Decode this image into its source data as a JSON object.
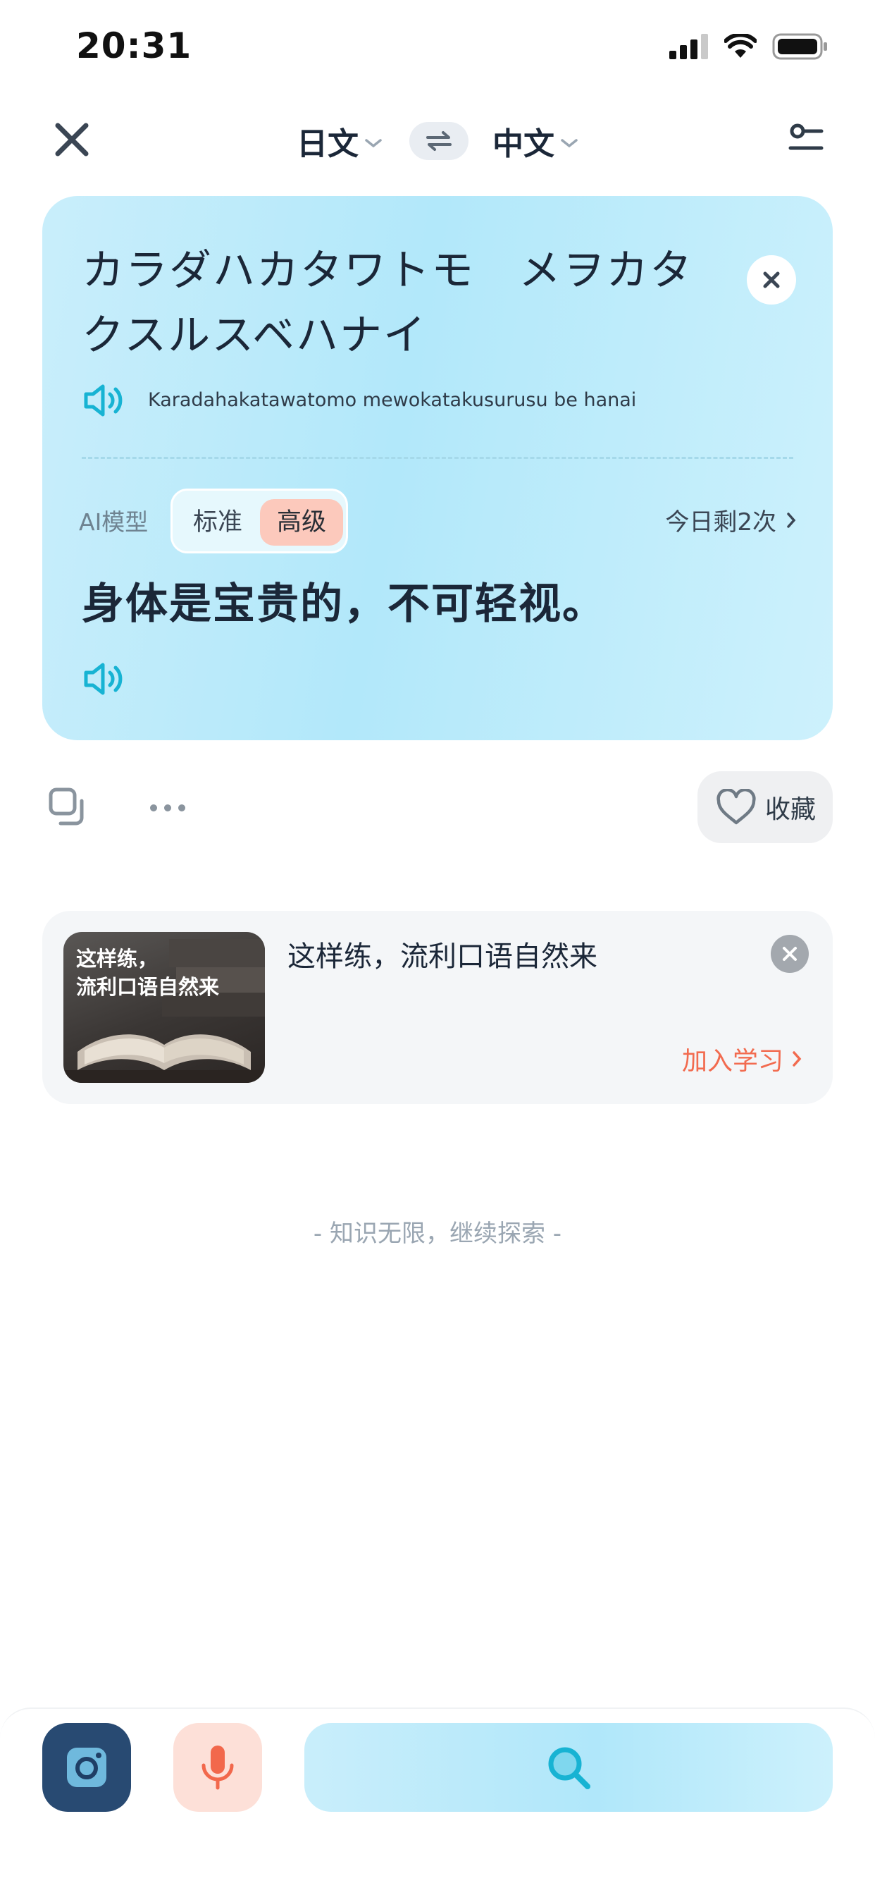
{
  "status_bar": {
    "time": "20:31"
  },
  "header": {
    "source_lang": "日文",
    "target_lang": "中文"
  },
  "translation": {
    "source_text": "カラダハカタワトモ　メヲカタクスルスベハナイ",
    "romanization": "Karadahakatawatomo mewokatakusurusu be hanai",
    "model_label": "AI模型",
    "model_standard": "标准",
    "model_advanced": "高级",
    "remaining": "今日剩2次",
    "result_text": "身体是宝贵的，不可轻视。"
  },
  "actions": {
    "favorite_label": "收藏"
  },
  "promo": {
    "thumb_text_line1": "这样练，",
    "thumb_text_line2": "流利口语自然来",
    "title": "这样练，流利口语自然来",
    "join_label": "加入学习"
  },
  "footer_note": "- 知识无限，继续探索 -",
  "colors": {
    "card_gradient": "#b2e8fa",
    "accent_teal": "#17b3d3",
    "accent_orange": "#f26b4f",
    "camera_bg": "#284a72",
    "mic_bg": "#fde0d8"
  },
  "icons": {
    "close": "close-icon",
    "swap": "swap-icon",
    "settings": "settings-icon",
    "speaker": "speaker-icon",
    "copy": "copy-icon",
    "more": "more-icon",
    "heart": "heart-icon",
    "camera": "camera-icon",
    "mic": "microphone-icon",
    "search": "search-icon"
  }
}
